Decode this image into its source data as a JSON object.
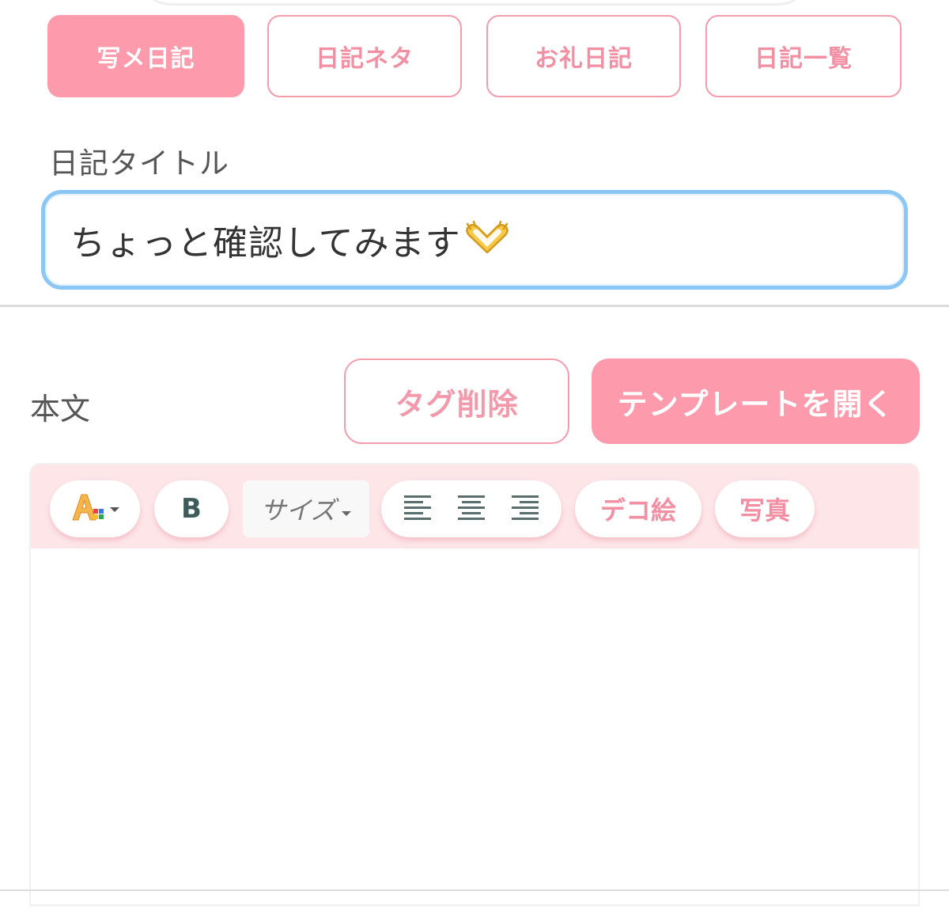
{
  "tabs": [
    {
      "label": "写メ日記",
      "active": true
    },
    {
      "label": "日記ネタ",
      "active": false
    },
    {
      "label": "お礼日記",
      "active": false
    },
    {
      "label": "日記一覧",
      "active": false
    }
  ],
  "title_section": {
    "label": "日記タイトル",
    "value": "ちょっと確認してみます",
    "emoji_icon": "heart-hands-icon"
  },
  "body_section": {
    "label": "本文",
    "tag_delete_label": "タグ削除",
    "open_template_label": "テンプレートを開く"
  },
  "editor_toolbar": {
    "size_label": "サイズ",
    "deco_label": "デコ絵",
    "photo_label": "写真",
    "bold_label": "B"
  },
  "colors": {
    "accent_pink": "#fd9aab",
    "pink_border": "#f49bac",
    "toolbar_bg": "#fde5e8",
    "focus_blue": "#8cc6f5"
  }
}
